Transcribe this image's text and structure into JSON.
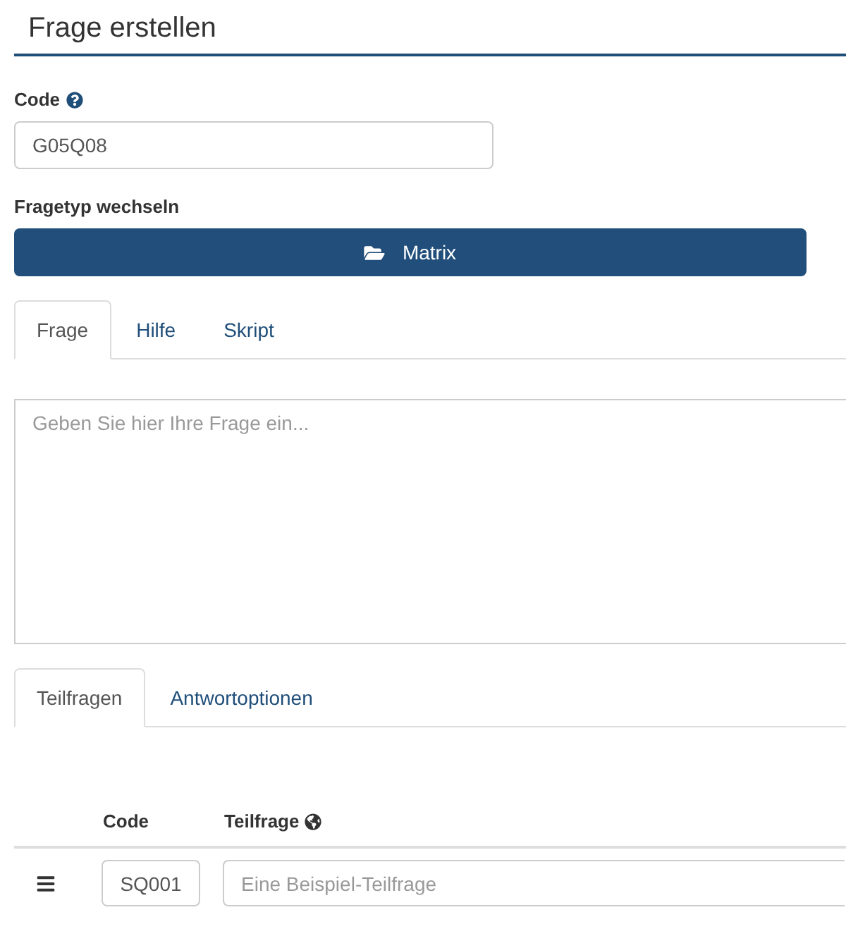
{
  "header": {
    "title": "Frage erstellen"
  },
  "code_field": {
    "label": "Code",
    "value": "G05Q08"
  },
  "question_type": {
    "label": "Fragetyp wechseln",
    "button": "Matrix"
  },
  "question_tabs": [
    {
      "label": "Frage",
      "selected": true
    },
    {
      "label": "Hilfe",
      "selected": false
    },
    {
      "label": "Skript",
      "selected": false
    }
  ],
  "question_editor": {
    "placeholder": "Geben Sie hier Ihre Frage ein..."
  },
  "subquestion_tabs": [
    {
      "label": "Teilfragen",
      "selected": true
    },
    {
      "label": "Antwortoptionen",
      "selected": false
    }
  ],
  "subquestions": {
    "columns": [
      "Code",
      "Teilfrage"
    ],
    "rows": [
      {
        "code": "SQ001",
        "placeholder": "Eine Beispiel-Teilfrage"
      }
    ]
  }
}
